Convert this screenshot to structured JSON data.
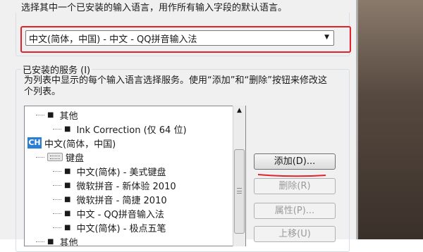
{
  "top_text": "选择其中一个已安装的输入语言，用作所有输入字段的默认语言。",
  "default_language_combo": {
    "value": "中文(简体，中国) - 中文 - QQ拼音输入法"
  },
  "services": {
    "group_label": "已安装的服务 (I)",
    "description": "为列表中显示的每个输入语言选择服务。使用“添加”和“删除”按钮来修改这个列表。",
    "tree": [
      {
        "label": "其他",
        "kind": "bullet",
        "indent": 1
      },
      {
        "label": "Ink Correction (仅 64 位)",
        "kind": "bullet",
        "indent": 2
      },
      {
        "label": "中文(简体，中国)",
        "kind": "lang",
        "badge": "CH",
        "indent": 0
      },
      {
        "label": "键盘",
        "kind": "keyboard",
        "indent": 1
      },
      {
        "label": "中文(简体) - 美式键盘",
        "kind": "bullet",
        "indent": 2
      },
      {
        "label": "微软拼音 - 新体验 2010",
        "kind": "bullet",
        "indent": 2
      },
      {
        "label": "微软拼音 - 简捷 2010",
        "kind": "bullet",
        "indent": 2
      },
      {
        "label": "中文 - QQ拼音输入法",
        "kind": "bullet",
        "indent": 2
      },
      {
        "label": "中文(简体) - 极点五笔",
        "kind": "bullet",
        "indent": 2
      },
      {
        "label": "其他",
        "kind": "bullet",
        "indent": 1
      }
    ]
  },
  "buttons": {
    "add": "添加(D)...",
    "remove": "删除(R)",
    "properties": "属性(P)...",
    "move_up": "上移(U)"
  },
  "colors": {
    "highlight_red": "#e0232c",
    "badge_blue": "#2a7fd4"
  }
}
